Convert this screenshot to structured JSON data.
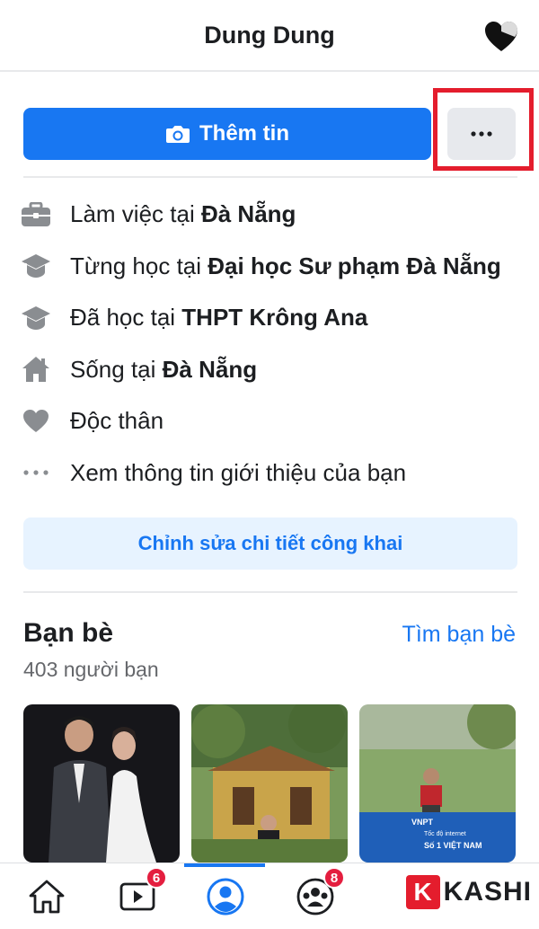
{
  "header": {
    "title": "Dung Dung",
    "icon": "heart-icon"
  },
  "actions": {
    "add_story_label": "Thêm tin",
    "more_label": "..."
  },
  "intro": {
    "items": [
      {
        "icon": "briefcase-icon",
        "prefix": "Làm việc tại ",
        "bold": "Đà Nẵng"
      },
      {
        "icon": "graduation-cap-icon",
        "prefix": "Từng học tại ",
        "bold": "Đại học Sư phạm Đà Nẵng"
      },
      {
        "icon": "graduation-cap-icon",
        "prefix": "Đã học tại ",
        "bold": "THPT Krông Ana"
      },
      {
        "icon": "home-icon",
        "prefix": "Sống tại ",
        "bold": "Đà Nẵng"
      },
      {
        "icon": "heart-icon",
        "prefix": "Độc thân",
        "bold": ""
      },
      {
        "icon": "more-dots-icon",
        "prefix": "Xem thông tin giới thiệu của bạn",
        "bold": ""
      }
    ],
    "edit_button": "Chỉnh sửa chi tiết công khai"
  },
  "friends": {
    "title": "Bạn bè",
    "find_link": "Tìm bạn bè",
    "count": "403 người bạn",
    "photo_caption": {
      "line1": "VNPT",
      "line2": "Tốc độ internet",
      "line3": "Số 1 VIỆT NAM"
    }
  },
  "tabbar": {
    "tabs": [
      {
        "name": "home",
        "badge": ""
      },
      {
        "name": "watch",
        "badge": "6"
      },
      {
        "name": "profile",
        "badge": ""
      },
      {
        "name": "groups",
        "badge": "8"
      }
    ]
  },
  "watermark": {
    "letter": "K",
    "text": "KASHI"
  },
  "colors": {
    "accent": "#1877f2",
    "highlight": "#e41d2d",
    "badge": "#e41e3f"
  }
}
